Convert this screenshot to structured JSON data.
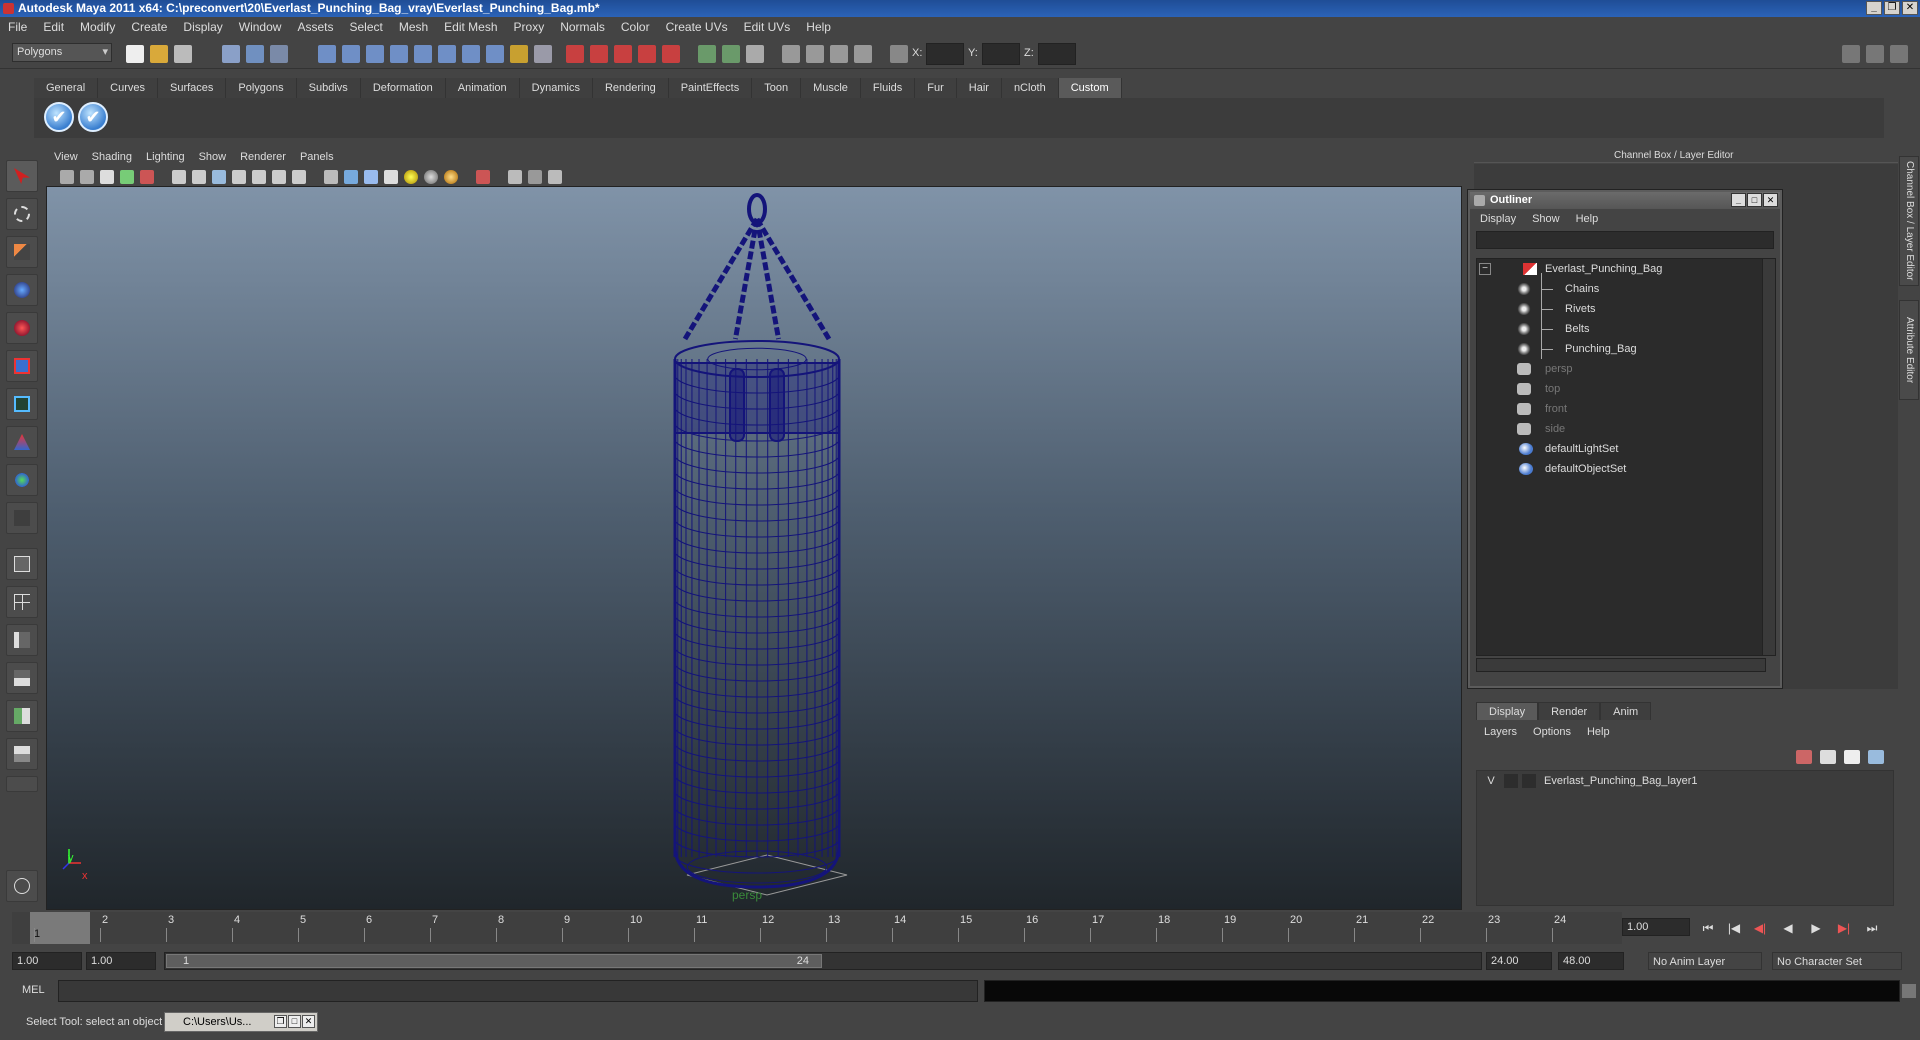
{
  "window": {
    "title": "Autodesk Maya 2011 x64: C:\\preconvert\\20\\Everlast_Punching_Bag_vray\\Everlast_Punching_Bag.mb*"
  },
  "menu": [
    "File",
    "Edit",
    "Modify",
    "Create",
    "Display",
    "Window",
    "Assets",
    "Select",
    "Mesh",
    "Edit Mesh",
    "Proxy",
    "Normals",
    "Color",
    "Create UVs",
    "Edit UVs",
    "Help"
  ],
  "status_line": {
    "mode": "Polygons",
    "x_label": "X:",
    "y_label": "Y:",
    "z_label": "Z:"
  },
  "shelf": {
    "tabs": [
      "General",
      "Curves",
      "Surfaces",
      "Polygons",
      "Subdivs",
      "Deformation",
      "Animation",
      "Dynamics",
      "Rendering",
      "PaintEffects",
      "Toon",
      "Muscle",
      "Fluids",
      "Fur",
      "Hair",
      "nCloth",
      "Custom"
    ],
    "active_tab": "Custom",
    "check_glyph": "✔"
  },
  "viewport": {
    "menu": [
      "View",
      "Shading",
      "Lighting",
      "Show",
      "Renderer",
      "Panels"
    ],
    "camera": "persp",
    "axis_y": "y",
    "axis_x": "x",
    "wire_color": "#14147a"
  },
  "right_panel": {
    "title": "Channel Box / Layer Editor",
    "side_tab_1": "Channel Box / Layer Editor",
    "side_tab_2": "Attribute Editor"
  },
  "outliner": {
    "title": "Outliner",
    "menu": [
      "Display",
      "Show",
      "Help"
    ],
    "collapse_glyph": "−",
    "items": [
      {
        "label": "Everlast_Punching_Bag",
        "dim": false
      },
      {
        "label": "Chains",
        "dim": false
      },
      {
        "label": "Rivets",
        "dim": false
      },
      {
        "label": "Belts",
        "dim": false
      },
      {
        "label": "Punching_Bag",
        "dim": false
      },
      {
        "label": "persp",
        "dim": true
      },
      {
        "label": "top",
        "dim": true
      },
      {
        "label": "front",
        "dim": true
      },
      {
        "label": "side",
        "dim": true
      },
      {
        "label": "defaultLightSet",
        "dim": false
      },
      {
        "label": "defaultObjectSet",
        "dim": false
      }
    ]
  },
  "layer_editor": {
    "tabs": [
      "Display",
      "Render",
      "Anim"
    ],
    "active_tab": "Display",
    "menu": [
      "Layers",
      "Options",
      "Help"
    ],
    "layers": [
      {
        "visible": "V",
        "name": "Everlast_Punching_Bag_layer1"
      }
    ]
  },
  "time_slider": {
    "current_frame_label": "1",
    "ticks": [
      "1",
      "2",
      "3",
      "4",
      "5",
      "6",
      "7",
      "8",
      "9",
      "10",
      "11",
      "12",
      "13",
      "14",
      "15",
      "16",
      "17",
      "18",
      "19",
      "20",
      "21",
      "22",
      "23",
      "24"
    ],
    "current_time": "1.00",
    "playback": [
      "⏮",
      "|◀",
      "◀|",
      "◀",
      "▶",
      "▶|",
      "⏭"
    ]
  },
  "range_slider": {
    "start": "1.00",
    "playback_start": "1.00",
    "handle_start": "1",
    "handle_end": "24",
    "playback_end": "24.00",
    "end": "48.00",
    "anim_layer": "No Anim Layer",
    "character_set": "No Character Set"
  },
  "command_line": {
    "label": "MEL"
  },
  "help_line": {
    "text": "Select Tool: select an object",
    "task_button": "C:\\Users\\Us..."
  }
}
